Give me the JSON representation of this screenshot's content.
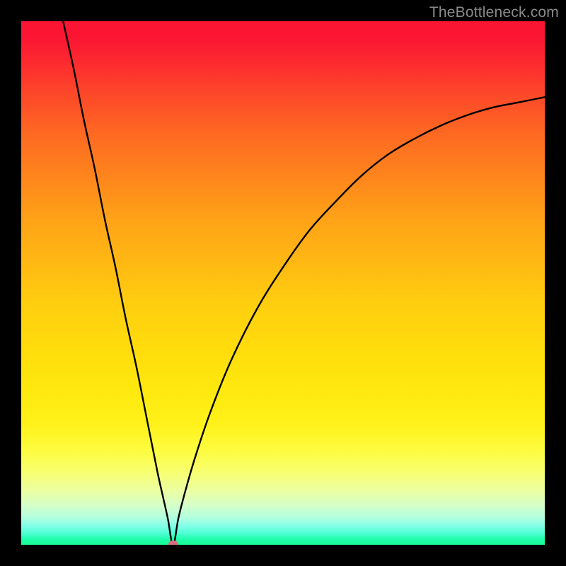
{
  "watermark": "TheBottleneck.com",
  "chart_data": {
    "type": "line",
    "title": "",
    "xlabel": "",
    "ylabel": "",
    "x_range": [
      0,
      100
    ],
    "y_range": [
      0,
      100
    ],
    "grid": false,
    "legend": false,
    "background_gradient": {
      "direction": "vertical",
      "stops": [
        {
          "pos": 0.0,
          "color": "#fb1533"
        },
        {
          "pos": 0.3,
          "color": "#fe861c"
        },
        {
          "pos": 0.6,
          "color": "#ffdb0c"
        },
        {
          "pos": 0.82,
          "color": "#fdfc3f"
        },
        {
          "pos": 0.93,
          "color": "#d5ffc8"
        },
        {
          "pos": 1.0,
          "color": "#18fe8f"
        }
      ]
    },
    "marker": {
      "x": 29,
      "y": 0,
      "color": "#db6e7f"
    },
    "series": [
      {
        "name": "curve",
        "color": "#000000",
        "x": [
          8,
          10,
          12,
          14,
          16,
          18,
          20,
          22,
          24,
          26,
          27,
          28,
          29,
          30,
          31,
          33,
          36,
          40,
          45,
          50,
          55,
          60,
          65,
          70,
          75,
          80,
          85,
          90,
          95,
          100
        ],
        "y": [
          100,
          91,
          81,
          72,
          62,
          53,
          43,
          34,
          24,
          14,
          9.5,
          5,
          0,
          5,
          9,
          16,
          25,
          35,
          45,
          53,
          60,
          65.5,
          70.5,
          74.5,
          77.5,
          80,
          82,
          83.5,
          84.5,
          85.5
        ]
      }
    ]
  }
}
